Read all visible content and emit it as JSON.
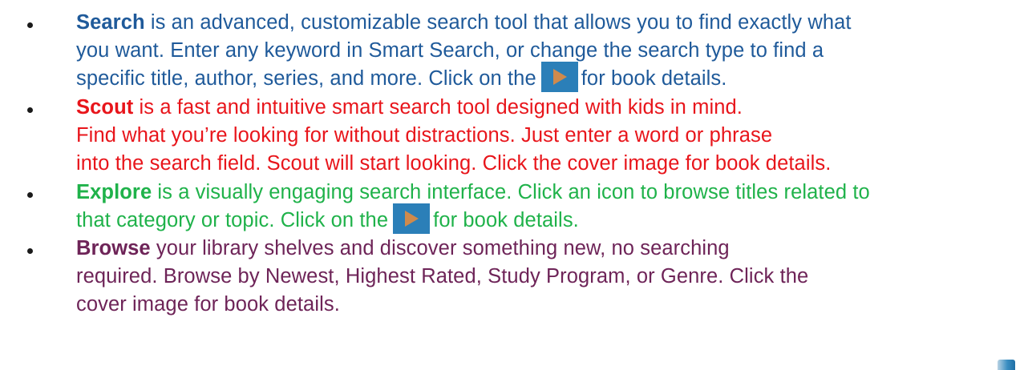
{
  "colors": {
    "search": "#1f5a9a",
    "scout": "#e8151b",
    "explore": "#1fb24a",
    "browse": "#6e2458",
    "play_button_bg": "#2b7fb8",
    "play_arrow": "#d08a4c"
  },
  "items": [
    {
      "keyword": "Search",
      "line1": " is an advanced, customizable search tool that allows you to find exactly what",
      "line2": "you want. Enter any keyword in Smart Search, or change the search type to find a",
      "line3_before": "specific title, author, series, and more. Click on the",
      "line3_after": "for book details.",
      "icon": "play-icon"
    },
    {
      "keyword": "Scout",
      "line1": " is a fast and intuitive smart search tool designed with kids in mind.",
      "line2": "Find what you’re looking for without distractions. Just enter a word or phrase",
      "line3": "into the search field. Scout will start looking. Click the cover image for book details."
    },
    {
      "keyword": "Explore",
      "line1": " is a visually engaging search interface. Click an icon to browse titles related to",
      "line2_before": "that category or topic. Click on the",
      "line2_after": "for book details.",
      "icon": "play-icon"
    },
    {
      "keyword": "Browse",
      "line1": " your library shelves and discover something new, no searching",
      "line2": "required. Browse by Newest, Highest Rated, Study Program, or Genre. Click the",
      "line3": "cover image for book details."
    }
  ]
}
